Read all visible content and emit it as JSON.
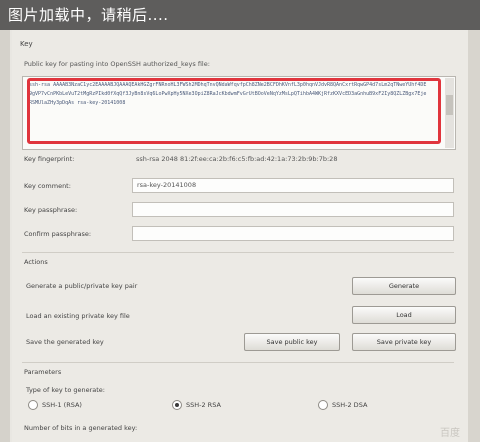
{
  "overlay": {
    "loading_text": "图片加载中，请稍后...."
  },
  "key_group": {
    "title": "Key",
    "description": "Public key for pasting into OpenSSH authorized_keys file:",
    "key_text": "ssh-rsa AAAAB3NzaC1yc2EAAAABJQAAAQEAkHGZgrFNRnoHL3FWSh2MDhqTnvQNdaWfqvfpCh8ZNe2BCFDhKVnfL3p0hqnVJdvR8QAnCxrtRqwGP4d7sLm2qTNweYUhf4DE9gVP7vCnPKbLeVuT2tMgRzPIkd0fXqQf3JyBn8sVq6LoPwXpHy5NXe3OpiZ8RaJcKbdwmFvGrUtBOoVeNqYzMsLpQTihbA4WKjRfzKXVcED3aGnhuB9xF2Iy8QZLZBgx7EjeRSMUlaZHy3pDqAs rsa-key-20141008"
  },
  "fingerprint": {
    "label": "Key fingerprint:",
    "value": "ssh-rsa 2048 81:2f:ee:ca:2b:f6:c5:fb:ad:42:1a:73:2b:9b:7b:28"
  },
  "comment": {
    "label": "Key comment:",
    "value": "rsa-key-20141008"
  },
  "passphrase": {
    "label": "Key passphrase:",
    "value": ""
  },
  "confirm": {
    "label": "Confirm passphrase:",
    "value": ""
  },
  "actions": {
    "title": "Actions",
    "generate_label": "Generate a public/private key pair",
    "generate_button": "Generate",
    "load_label": "Load an existing private key file",
    "load_button": "Load",
    "save_label": "Save the generated key",
    "save_public_button": "Save public key",
    "save_private_button": "Save private key"
  },
  "parameters": {
    "title": "Parameters",
    "type_label": "Type of key to generate:",
    "options": [
      "SSH-1 (RSA)",
      "SSH-2 RSA",
      "SSH-2 DSA"
    ],
    "selected_index": 1,
    "bits_label": "Number of bits in a generated key:"
  },
  "watermark": "百度"
}
